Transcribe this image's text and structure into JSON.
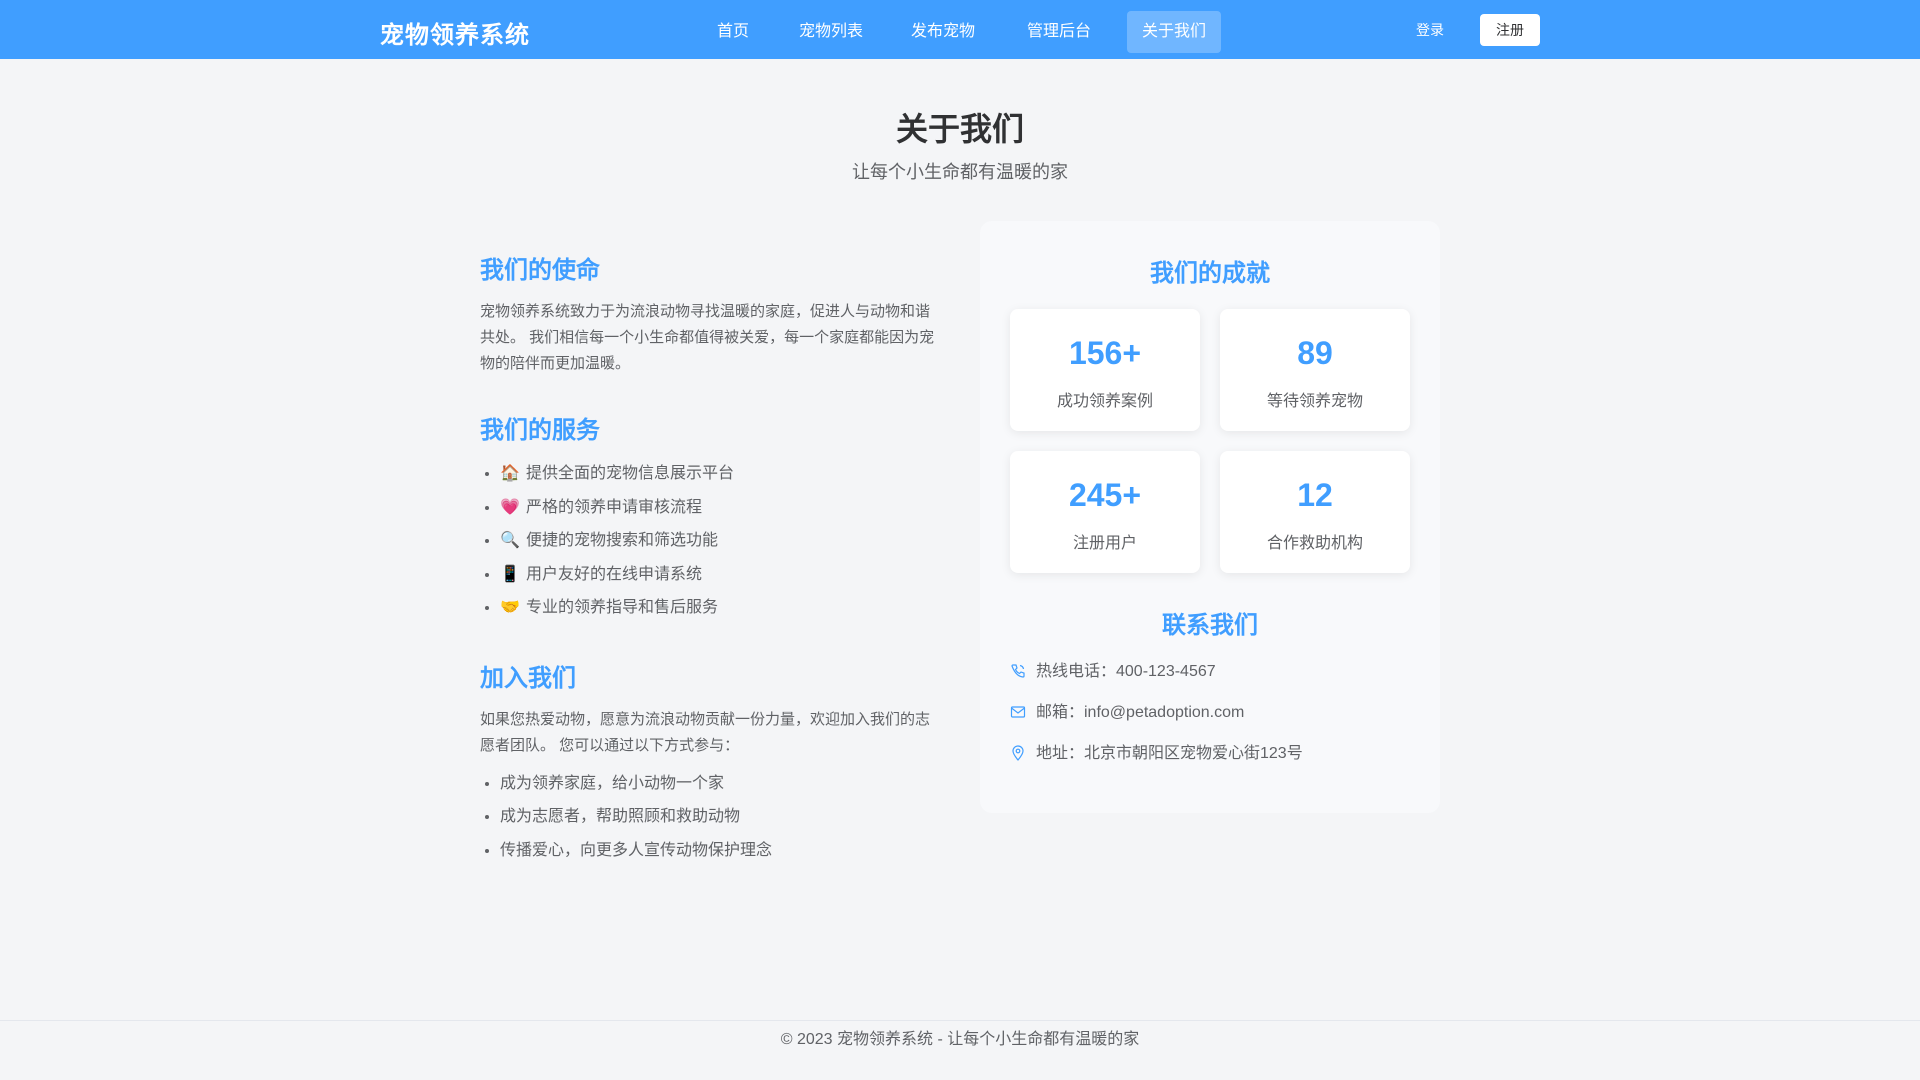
{
  "header": {
    "brand": "宠物领养系统",
    "nav": [
      {
        "label": "首页"
      },
      {
        "label": "宠物列表"
      },
      {
        "label": "发布宠物"
      },
      {
        "label": "管理后台"
      },
      {
        "label": "关于我们"
      }
    ],
    "active_nav": "关于我们",
    "login_label": "登录",
    "register_label": "注册"
  },
  "page": {
    "title": "关于我们",
    "subtitle": "让每个小生命都有温暖的家"
  },
  "mission": {
    "title": "我们的使命",
    "text": "宠物领养系统致力于为流浪动物寻找温暖的家庭，促进人与动物和谐共处。 我们相信每一个小生命都值得被关爱，每一个家庭都能因为宠物的陪伴而更加温暖。"
  },
  "services": {
    "title": "我们的服务",
    "items": [
      {
        "emoji": "🏠",
        "text": "提供全面的宠物信息展示平台"
      },
      {
        "emoji": "💗",
        "text": "严格的领养申请审核流程"
      },
      {
        "emoji": "🔍",
        "text": "便捷的宠物搜索和筛选功能"
      },
      {
        "emoji": "📱",
        "text": "用户友好的在线申请系统"
      },
      {
        "emoji": "🤝",
        "text": "专业的领养指导和售后服务"
      }
    ]
  },
  "join": {
    "title": "加入我们",
    "text": "如果您热爱动物，愿意为流浪动物贡献一份力量，欢迎加入我们的志愿者团队。 您可以通过以下方式参与：",
    "items": [
      "成为领养家庭，给小动物一个家",
      "成为志愿者，帮助照顾和救助动物",
      "传播爱心，向更多人宣传动物保护理念"
    ]
  },
  "achievements": {
    "title": "我们的成就",
    "stats": [
      {
        "value": "156+",
        "label": "成功领养案例"
      },
      {
        "value": "89",
        "label": "等待领养宠物"
      },
      {
        "value": "245+",
        "label": "注册用户"
      },
      {
        "value": "12",
        "label": "合作救助机构"
      }
    ]
  },
  "contact": {
    "title": "联系我们",
    "phone": "热线电话：400-123-4567",
    "email": "邮箱：info@petadoption.com",
    "address": "地址：北京市朝阳区宠物爱心街123号"
  },
  "footer": {
    "text": "© 2023 宠物领养系统 - 让每个小生命都有温暖的家"
  },
  "colors": {
    "primary": "#409eff",
    "text": "#606266",
    "heading": "#303133"
  }
}
